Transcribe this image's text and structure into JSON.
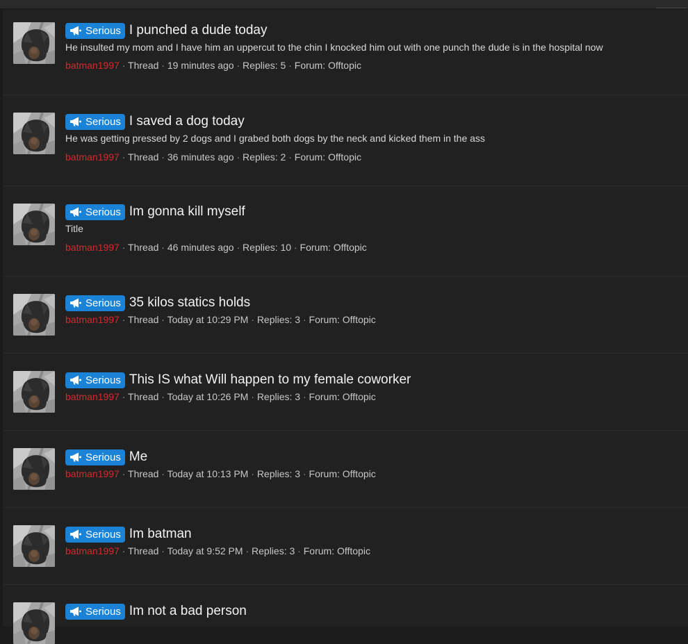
{
  "badge_label": "Serious",
  "colors": {
    "badge": "#1a83d8",
    "author": "#d42a2a",
    "background": "#212121"
  },
  "threads": [
    {
      "title": "I punched a dude today",
      "snippet": "He insulted my mom and I have him an uppercut to the chin I knocked him out with one punch the dude is in the hospital now",
      "author": "batman1997",
      "type": "Thread",
      "time": "19 minutes ago",
      "replies": "Replies: 5",
      "forum": "Forum: Offtopic"
    },
    {
      "title": "I saved a dog today",
      "snippet": "He was getting pressed by 2 dogs and I grabed both dogs by the neck and kicked them in the ass",
      "author": "batman1997",
      "type": "Thread",
      "time": "36 minutes ago",
      "replies": "Replies: 2",
      "forum": "Forum: Offtopic"
    },
    {
      "title": "Im gonna kill myself",
      "snippet": "Title",
      "author": "batman1997",
      "type": "Thread",
      "time": "46 minutes ago",
      "replies": "Replies: 10",
      "forum": "Forum: Offtopic"
    },
    {
      "title": "35 kilos statics holds",
      "snippet": "",
      "author": "batman1997",
      "type": "Thread",
      "time": "Today at 10:29 PM",
      "replies": "Replies: 3",
      "forum": "Forum: Offtopic"
    },
    {
      "title": "This IS what Will happen to my female coworker",
      "snippet": "",
      "author": "batman1997",
      "type": "Thread",
      "time": "Today at 10:26 PM",
      "replies": "Replies: 3",
      "forum": "Forum: Offtopic"
    },
    {
      "title": "Me",
      "snippet": "",
      "author": "batman1997",
      "type": "Thread",
      "time": "Today at 10:13 PM",
      "replies": "Replies: 3",
      "forum": "Forum: Offtopic"
    },
    {
      "title": "Im batman",
      "snippet": "",
      "author": "batman1997",
      "type": "Thread",
      "time": "Today at 9:52 PM",
      "replies": "Replies: 3",
      "forum": "Forum: Offtopic"
    },
    {
      "title": "Im not a bad person",
      "snippet": "",
      "author": "",
      "type": "",
      "time": "",
      "replies": "",
      "forum": ""
    }
  ]
}
